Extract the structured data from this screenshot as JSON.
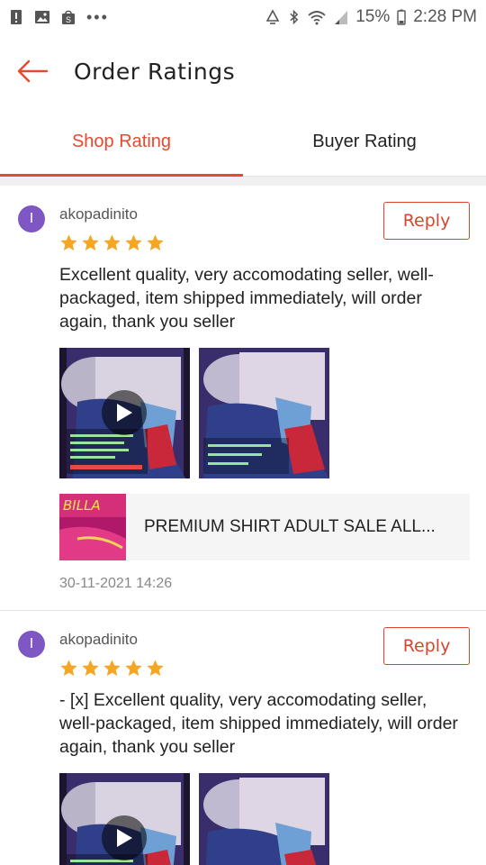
{
  "status_bar": {
    "battery": "15%",
    "time": "2:28 PM",
    "left_icons": [
      "alert-icon",
      "image-icon",
      "shopee-icon",
      "more-dots-icon"
    ],
    "right_icons": [
      "recycle-icon",
      "bluetooth-icon",
      "wifi-icon",
      "signal-icon",
      "battery-icon"
    ]
  },
  "header": {
    "title": "Order Ratings",
    "back_icon": "back-arrow-icon"
  },
  "tabs": [
    {
      "label": "Shop Rating",
      "active": true
    },
    {
      "label": "Buyer Rating",
      "active": false
    }
  ],
  "colors": {
    "accent": "#e6492d",
    "star": "#f5a623",
    "avatar": "#7e57c2"
  },
  "reviews": [
    {
      "avatar_letter": "I",
      "username": "akopadinito",
      "rating": 5,
      "reply_label": "Reply",
      "text": "Excellent quality, very accomodating seller, well-packaged, item shipped immediately, will order again, thank you seller",
      "media": [
        "video",
        "image"
      ],
      "product": {
        "name": "PREMIUM SHIRT ADULT  SALE ALL...",
        "thumb_text": "BILLA"
      },
      "date": "30-11-2021 14:26"
    },
    {
      "avatar_letter": "I",
      "username": "akopadinito",
      "rating": 5,
      "reply_label": "Reply",
      "text": "- [x] Excellent quality, very accomodating seller, well-packaged, item shipped immediately, will order again, thank you seller",
      "media": [
        "video",
        "image"
      ]
    }
  ]
}
